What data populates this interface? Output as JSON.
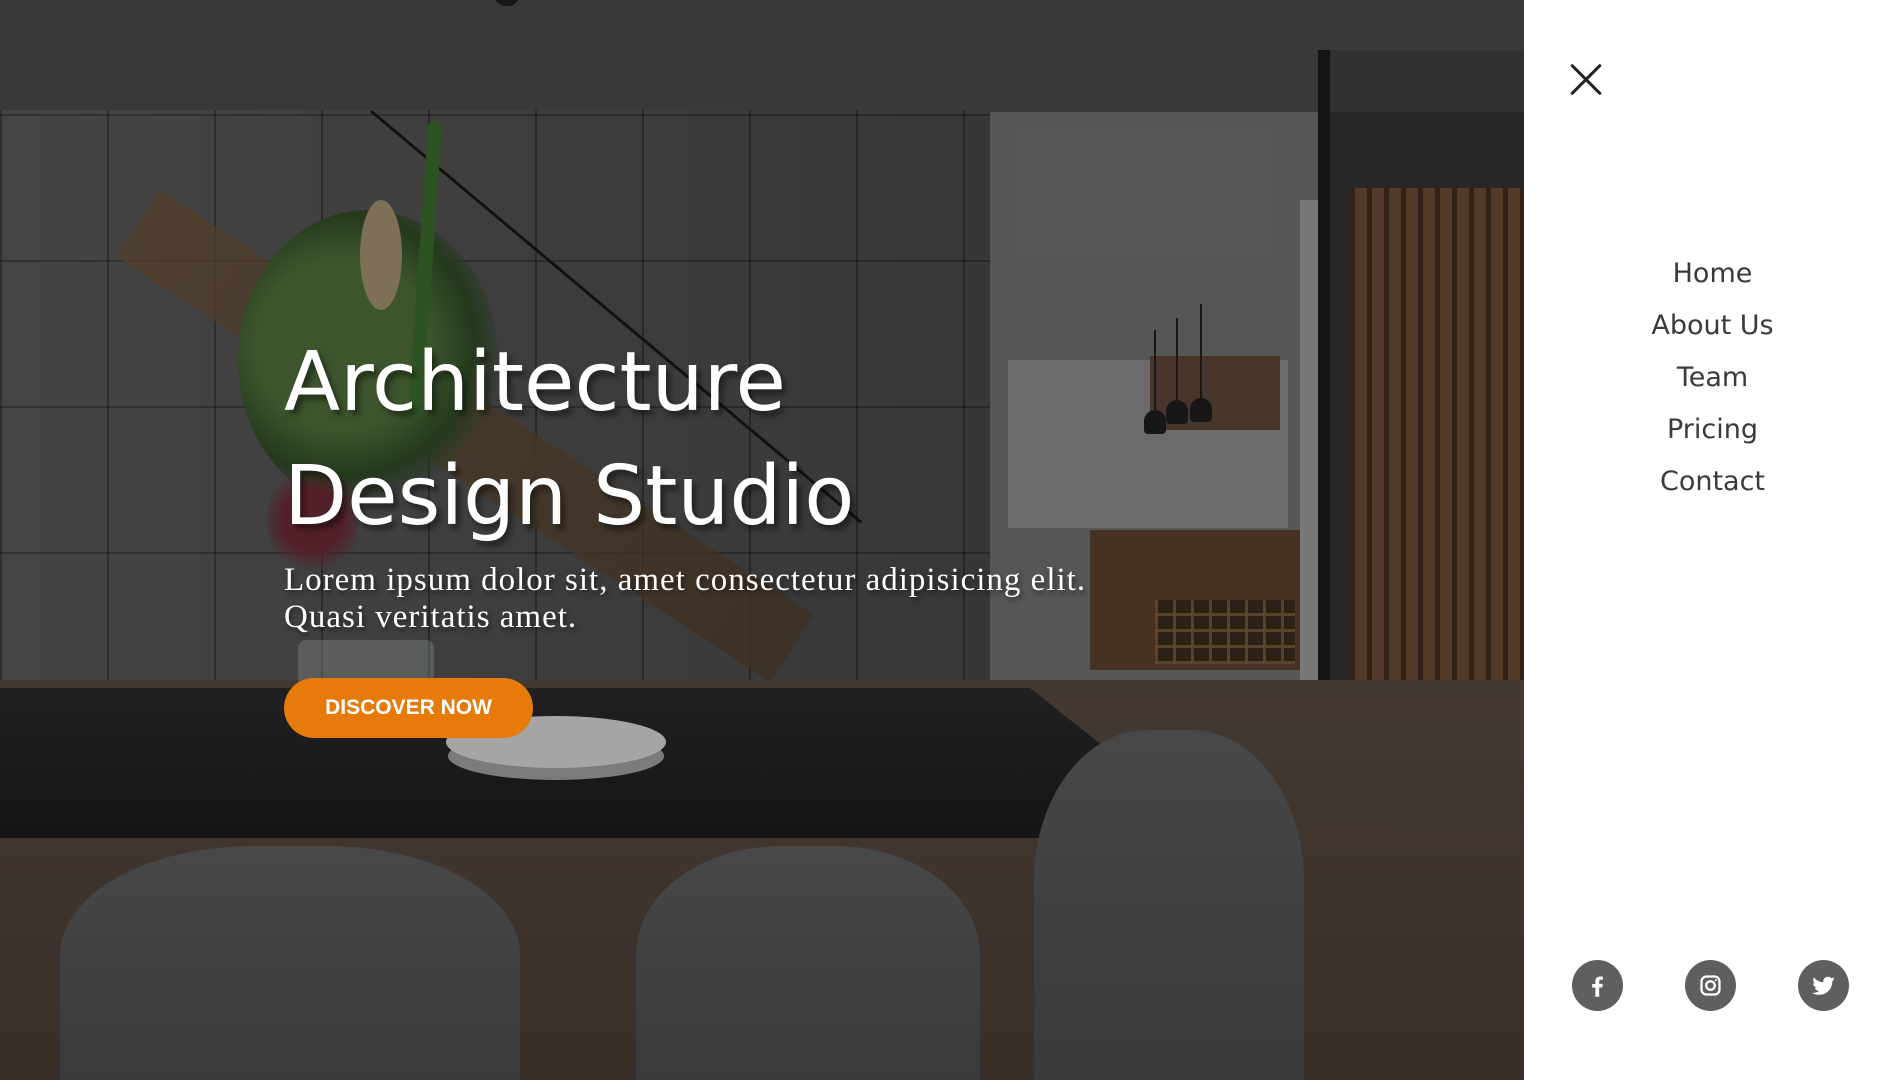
{
  "hero": {
    "title_line1": "Architecture",
    "title_line2": "Design Studio",
    "description": "Lorem ipsum dolor sit, amet consectetur adipisicing elit. Quasi veritatis amet.",
    "cta_label": "DISCOVER NOW"
  },
  "menu": {
    "items": [
      {
        "label": "Home"
      },
      {
        "label": "About Us"
      },
      {
        "label": "Team"
      },
      {
        "label": "Pricing"
      },
      {
        "label": "Contact"
      }
    ],
    "socials": [
      {
        "icon": "facebook-icon"
      },
      {
        "icon": "instagram-icon"
      },
      {
        "icon": "twitter-icon"
      }
    ]
  },
  "colors": {
    "accent": "#e67a0a",
    "social_bg": "#5f5f5f",
    "menu_text": "#3a3a3a"
  }
}
